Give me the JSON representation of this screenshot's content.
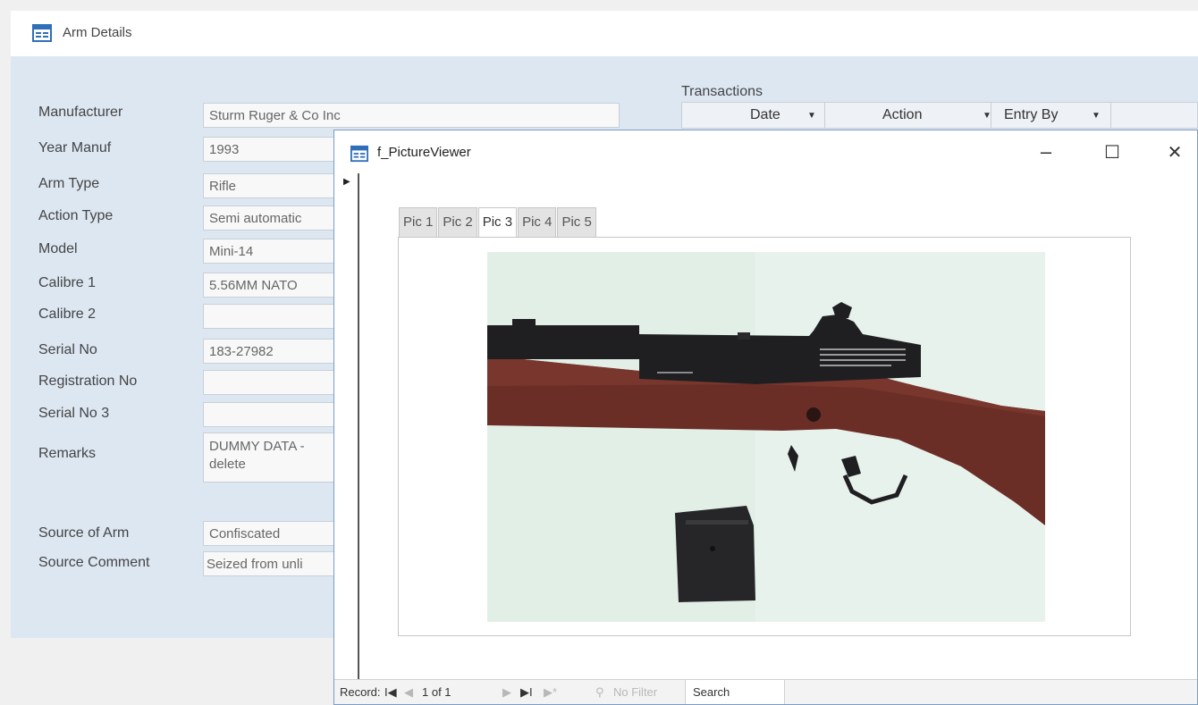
{
  "arm_form": {
    "title": "Arm Details",
    "fields": [
      {
        "label": "Manufacturer",
        "value": "Sturm Ruger & Co Inc"
      },
      {
        "label": "Year Manuf",
        "value": "1993"
      },
      {
        "label": "Arm Type",
        "value": "Rifle"
      },
      {
        "label": "Action Type",
        "value": "Semi automatic"
      },
      {
        "label": "Model",
        "value": "Mini-14"
      },
      {
        "label": "Calibre 1",
        "value": "5.56MM NATO"
      },
      {
        "label": "Calibre 2",
        "value": ""
      },
      {
        "label": "Serial No",
        "value": "183-27982"
      },
      {
        "label": "Registration No",
        "value": ""
      },
      {
        "label": "Serial No 3",
        "value": ""
      },
      {
        "label": "Remarks",
        "value": "DUMMY DATA - delete"
      },
      {
        "label": "Source of Arm",
        "value": "Confiscated"
      },
      {
        "label": "Source Comment",
        "value": "Seized from unli"
      }
    ],
    "transactions": {
      "label": "Transactions",
      "columns": [
        "Date",
        "Action",
        "Entry By"
      ]
    }
  },
  "viewer": {
    "title": "f_PictureViewer",
    "window_buttons": {
      "minimize": "–",
      "maximize": "☐",
      "close": "✕"
    },
    "tabs": [
      "Pic 1",
      "Pic 2",
      "Pic 3",
      "Pic 4",
      "Pic 5"
    ],
    "active_tab": "Pic 3",
    "nav": {
      "record_label": "Record:",
      "first": "I◀",
      "prev": "◀",
      "position": "1 of 1",
      "next": "▶",
      "last": "▶I",
      "new": "▶*",
      "filter": "No Filter",
      "search": "Search"
    }
  },
  "colors": {
    "form_body": "#dde7f2",
    "viewer_border": "#7a9cc4",
    "stock_wood": "#6b2e26",
    "receiver_metal": "#1f1f22"
  },
  "icons": [
    "form-icon",
    "record-selector-arrow-icon",
    "sort-arrow-icon",
    "filter-icon"
  ]
}
